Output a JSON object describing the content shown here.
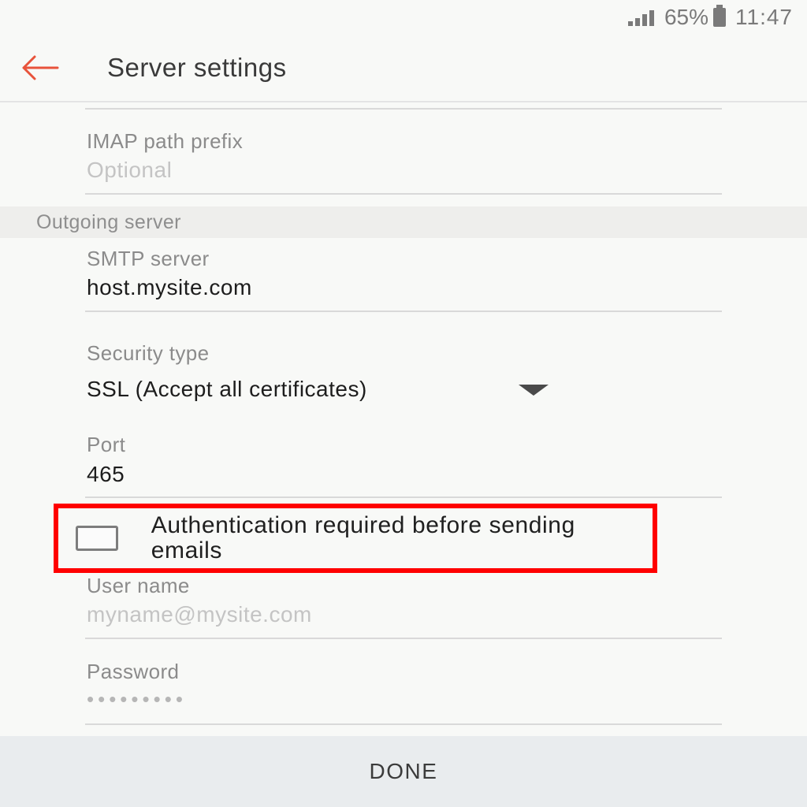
{
  "status_bar": {
    "battery": "65%",
    "time": "11:47"
  },
  "app_bar": {
    "title": "Server settings"
  },
  "imap_path_prefix": {
    "label": "IMAP path prefix",
    "placeholder": "Optional"
  },
  "outgoing_section": {
    "header": "Outgoing server"
  },
  "smtp_server": {
    "label": "SMTP server",
    "value": "host.mysite.com"
  },
  "security_type": {
    "label": "Security type",
    "value": "SSL (Accept all certificates)"
  },
  "port": {
    "label": "Port",
    "value": "465"
  },
  "authentication": {
    "label": "Authentication required before sending emails",
    "checked": false
  },
  "user_name": {
    "label": "User name",
    "placeholder": "myname@mysite.com"
  },
  "password": {
    "label": "Password",
    "masked": "•••••••••"
  },
  "footer": {
    "done_label": "DONE"
  },
  "colors": {
    "accent": "#e8533b",
    "highlight": "#ff0000",
    "background": "#f8f9f7"
  }
}
